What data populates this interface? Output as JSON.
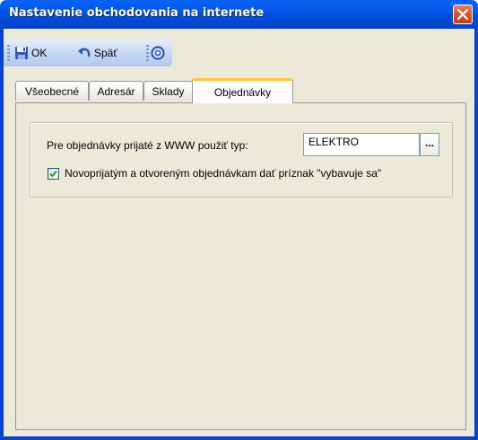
{
  "window": {
    "title": "Nastavenie obchodovania na internete"
  },
  "toolbar": {
    "ok_label": "OK",
    "back_label": "Späť"
  },
  "tabs": [
    {
      "label": "Všeobecné",
      "active": false
    },
    {
      "label": "Adresár",
      "active": false
    },
    {
      "label": "Sklady",
      "active": false
    },
    {
      "label": "Objednávky",
      "active": true
    }
  ],
  "orders": {
    "type_label": "Pre objednávky prijaté z WWW použiť typ:",
    "type_value": "ELEKTRO",
    "browse_label": "...",
    "flag_label": "Novoprijatým a otvoreným objednávkam dať príznak \"vybavuje sa\"",
    "flag_checked": true
  }
}
